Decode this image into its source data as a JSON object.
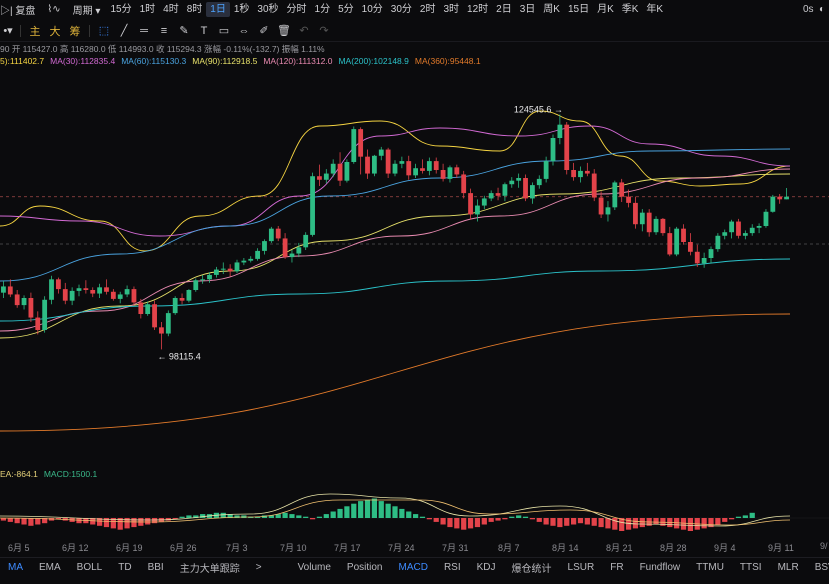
{
  "toolbar": {
    "left_partial": "▷| 复盘",
    "chart_style_icon": "line-chart-icon",
    "period_label": "周期",
    "timeframes": [
      "15分",
      "1时",
      "4时",
      "8时",
      "1日",
      "1秒",
      "30秒",
      "分时",
      "1分",
      "5分",
      "10分",
      "30分",
      "2时",
      "3时",
      "12时",
      "2日",
      "3日",
      "周K",
      "15日",
      "月K",
      "季K",
      "年K"
    ],
    "active_timeframe": "1日",
    "right_text": "0s"
  },
  "drawing_toolbar": {
    "labels": [
      "主",
      "大",
      "筹"
    ]
  },
  "ohlc_info": "90 开 115427.0 高 116280.0 低 114993.0 收 115294.3 涨幅 -0.11%(-132.7) 振幅 1.11%",
  "ma_legend": [
    {
      "text": "5):111402.7",
      "color": "#f5d442"
    },
    {
      "text": "MA(30):112835.4",
      "color": "#d36ad4"
    },
    {
      "text": "MA(60):115130.3",
      "color": "#4aa3df"
    },
    {
      "text": "MA(90):112918.5",
      "color": "#e6e06a"
    },
    {
      "text": "MA(120):111312.0",
      "color": "#e88ab0"
    },
    {
      "text": "MA(200):102148.9",
      "color": "#2bc2c9"
    },
    {
      "text": "MA(360):95448.1",
      "color": "#e27a2a"
    }
  ],
  "annotations": {
    "high": "124545.6",
    "low": "98115.4"
  },
  "macd_legend": [
    {
      "text": "EA:-864.1",
      "color": "#e6d27a"
    },
    {
      "text": "MACD:1500.1",
      "color": "#3ab98a"
    }
  ],
  "date_labels": [
    "6月 5",
    "6月 12",
    "6月 19",
    "6月 26",
    "7月 3",
    "7月 10",
    "7月 17",
    "7月 24",
    "7月 31",
    "8月 7",
    "8月 14",
    "8月 21",
    "8月 28",
    "9月 4",
    "9月 11",
    "9/"
  ],
  "indicator_tabs": [
    "MA",
    "EMA",
    "BOLL",
    "TD",
    "BBI",
    "主力大单跟踪",
    ">",
    "Volume",
    "Position",
    "MACD",
    "RSI",
    "KDJ",
    "爆仓统计",
    "LSUR",
    "FR",
    "Fundflow",
    "TTMU",
    "TTSI",
    "MLR",
    "BSVR"
  ],
  "active_tab_main": "MA",
  "active_tab_sub": "MACD",
  "chart_data": {
    "type": "candlestick",
    "ylim": [
      85000,
      130000
    ],
    "candles": [
      [
        104500,
        105800,
        103900,
        105200
      ],
      [
        105200,
        106000,
        104000,
        104300
      ],
      [
        104300,
        104800,
        102800,
        103100
      ],
      [
        103100,
        104200,
        102600,
        103900
      ],
      [
        103900,
        104500,
        101200,
        101700
      ],
      [
        101700,
        102400,
        99800,
        100300
      ],
      [
        100300,
        104100,
        100000,
        103700
      ],
      [
        103700,
        106400,
        103200,
        106000
      ],
      [
        106000,
        106200,
        104400,
        104900
      ],
      [
        104900,
        105600,
        103200,
        103600
      ],
      [
        103600,
        105100,
        103100,
        104700
      ],
      [
        104700,
        105400,
        104100,
        105000
      ],
      [
        105000,
        105900,
        104400,
        104800
      ],
      [
        104800,
        105100,
        104000,
        104400
      ],
      [
        104400,
        105500,
        103900,
        105100
      ],
      [
        105100,
        106000,
        104300,
        104600
      ],
      [
        104600,
        104900,
        103600,
        103800
      ],
      [
        103800,
        104600,
        103300,
        104300
      ],
      [
        104300,
        105300,
        104000,
        104900
      ],
      [
        104900,
        105200,
        103100,
        103400
      ],
      [
        103400,
        103800,
        101600,
        102100
      ],
      [
        102100,
        103500,
        101900,
        103200
      ],
      [
        103200,
        103600,
        100300,
        100600
      ],
      [
        100600,
        101200,
        98115,
        99900
      ],
      [
        99900,
        102500,
        99600,
        102200
      ],
      [
        102200,
        104100,
        102000,
        103900
      ],
      [
        103900,
        104400,
        103200,
        103600
      ],
      [
        103600,
        104900,
        103400,
        104800
      ],
      [
        104800,
        106100,
        104600,
        105900
      ],
      [
        105900,
        106500,
        105500,
        106000
      ],
      [
        106000,
        106800,
        105600,
        106500
      ],
      [
        106500,
        107400,
        106200,
        107100
      ],
      [
        107100,
        107900,
        106600,
        107200
      ],
      [
        107200,
        107700,
        106300,
        106900
      ],
      [
        106900,
        108200,
        106700,
        107900
      ],
      [
        107900,
        108400,
        107600,
        108100
      ],
      [
        108100,
        108600,
        107900,
        108300
      ],
      [
        108300,
        109500,
        108100,
        109200
      ],
      [
        109200,
        110500,
        108800,
        110300
      ],
      [
        110300,
        111900,
        110100,
        111700
      ],
      [
        111700,
        112000,
        110300,
        110600
      ],
      [
        110600,
        111200,
        108300,
        108500
      ],
      [
        108500,
        109300,
        107900,
        108900
      ],
      [
        108900,
        110100,
        108500,
        109600
      ],
      [
        109600,
        111300,
        109300,
        111000
      ],
      [
        111000,
        118000,
        110800,
        117600
      ],
      [
        117600,
        118900,
        116500,
        117200
      ],
      [
        117200,
        118400,
        116800,
        117900
      ],
      [
        117900,
        119500,
        117500,
        119000
      ],
      [
        119000,
        120300,
        116500,
        117100
      ],
      [
        117100,
        119500,
        116900,
        119200
      ],
      [
        119200,
        123200,
        119000,
        122900
      ],
      [
        122900,
        123100,
        117800,
        119800
      ],
      [
        119800,
        120600,
        117300,
        117900
      ],
      [
        117900,
        120000,
        117600,
        119900
      ],
      [
        119900,
        120900,
        119400,
        120600
      ],
      [
        120600,
        120800,
        117400,
        117900
      ],
      [
        117900,
        119400,
        117600,
        119000
      ],
      [
        119000,
        119800,
        118500,
        119300
      ],
      [
        119300,
        119900,
        117200,
        117700
      ],
      [
        117700,
        119000,
        117400,
        118500
      ],
      [
        118500,
        119500,
        117900,
        118200
      ],
      [
        118200,
        119700,
        117700,
        119300
      ],
      [
        119300,
        119700,
        117900,
        118300
      ],
      [
        118300,
        119000,
        117000,
        117300
      ],
      [
        117300,
        118800,
        116900,
        118600
      ],
      [
        118600,
        118900,
        117400,
        117800
      ],
      [
        117800,
        118200,
        115100,
        115700
      ],
      [
        115700,
        116200,
        112700,
        113300
      ],
      [
        113300,
        115000,
        112500,
        114300
      ],
      [
        114300,
        115400,
        113900,
        115100
      ],
      [
        115100,
        116000,
        114800,
        115700
      ],
      [
        115700,
        116300,
        114900,
        115400
      ],
      [
        115400,
        116900,
        114800,
        116700
      ],
      [
        116700,
        117500,
        116300,
        117100
      ],
      [
        117100,
        117900,
        116300,
        117400
      ],
      [
        117400,
        117800,
        114800,
        115100
      ],
      [
        115100,
        116900,
        114500,
        116600
      ],
      [
        116600,
        117700,
        116200,
        117300
      ],
      [
        117300,
        119800,
        116900,
        119300
      ],
      [
        119300,
        122300,
        118800,
        121900
      ],
      [
        121900,
        124545.6,
        121200,
        123400
      ],
      [
        123400,
        123700,
        117800,
        118300
      ],
      [
        118300,
        119100,
        117100,
        117500
      ],
      [
        117500,
        118700,
        116900,
        118200
      ],
      [
        118200,
        119100,
        117600,
        117900
      ],
      [
        117900,
        118400,
        114800,
        115200
      ],
      [
        115200,
        115900,
        112900,
        113300
      ],
      [
        113300,
        114800,
        112500,
        114100
      ],
      [
        114100,
        117100,
        113800,
        116900
      ],
      [
        116900,
        117300,
        114700,
        115300
      ],
      [
        115300,
        116100,
        114100,
        114600
      ],
      [
        114600,
        115300,
        111700,
        112200
      ],
      [
        112200,
        113900,
        111400,
        113500
      ],
      [
        113500,
        113900,
        110800,
        111300
      ],
      [
        111300,
        113100,
        111000,
        112800
      ],
      [
        112800,
        112900,
        110900,
        111200
      ],
      [
        111200,
        111900,
        108600,
        108800
      ],
      [
        108800,
        111900,
        108600,
        111700
      ],
      [
        111700,
        112200,
        109900,
        110200
      ],
      [
        110200,
        111200,
        108700,
        109100
      ],
      [
        109100,
        109900,
        107400,
        107800
      ],
      [
        107800,
        109000,
        107300,
        108400
      ],
      [
        108400,
        109700,
        107800,
        109400
      ],
      [
        109400,
        111200,
        109100,
        110900
      ],
      [
        110900,
        111600,
        110500,
        111300
      ],
      [
        111300,
        112700,
        110600,
        112500
      ],
      [
        112500,
        112800,
        110600,
        110900
      ],
      [
        110900,
        111500,
        110500,
        111200
      ],
      [
        111200,
        112200,
        110900,
        111800
      ],
      [
        111800,
        112300,
        111200,
        112000
      ],
      [
        112000,
        113900,
        111800,
        113600
      ],
      [
        113600,
        115500,
        113500,
        115300
      ],
      [
        115300,
        115600,
        114500,
        115000
      ],
      [
        115000,
        116280,
        114993,
        115294.3
      ]
    ],
    "ma_series": [
      {
        "name": "MA(5)",
        "color": "#f5d442",
        "values": [
          100500,
          115294
        ]
      },
      {
        "name": "MA(30)",
        "color": "#d36ad4",
        "values": [
          103000,
          112835
        ]
      },
      {
        "name": "MA(60)",
        "color": "#4aa3df",
        "values": [
          99500,
          115130
        ]
      },
      {
        "name": "MA(90)",
        "color": "#e6e06a",
        "values": [
          97000,
          112918
        ]
      },
      {
        "name": "MA(120)",
        "color": "#e88ab0",
        "values": [
          95000,
          111312
        ]
      },
      {
        "name": "MA(200)",
        "color": "#2bc2c9",
        "values": [
          96500,
          102149
        ]
      },
      {
        "name": "MA(360)",
        "color": "#e27a2a",
        "values": [
          88000,
          95448
        ]
      }
    ],
    "macd": {
      "dea": -864.1,
      "macd": 1500.1
    }
  }
}
